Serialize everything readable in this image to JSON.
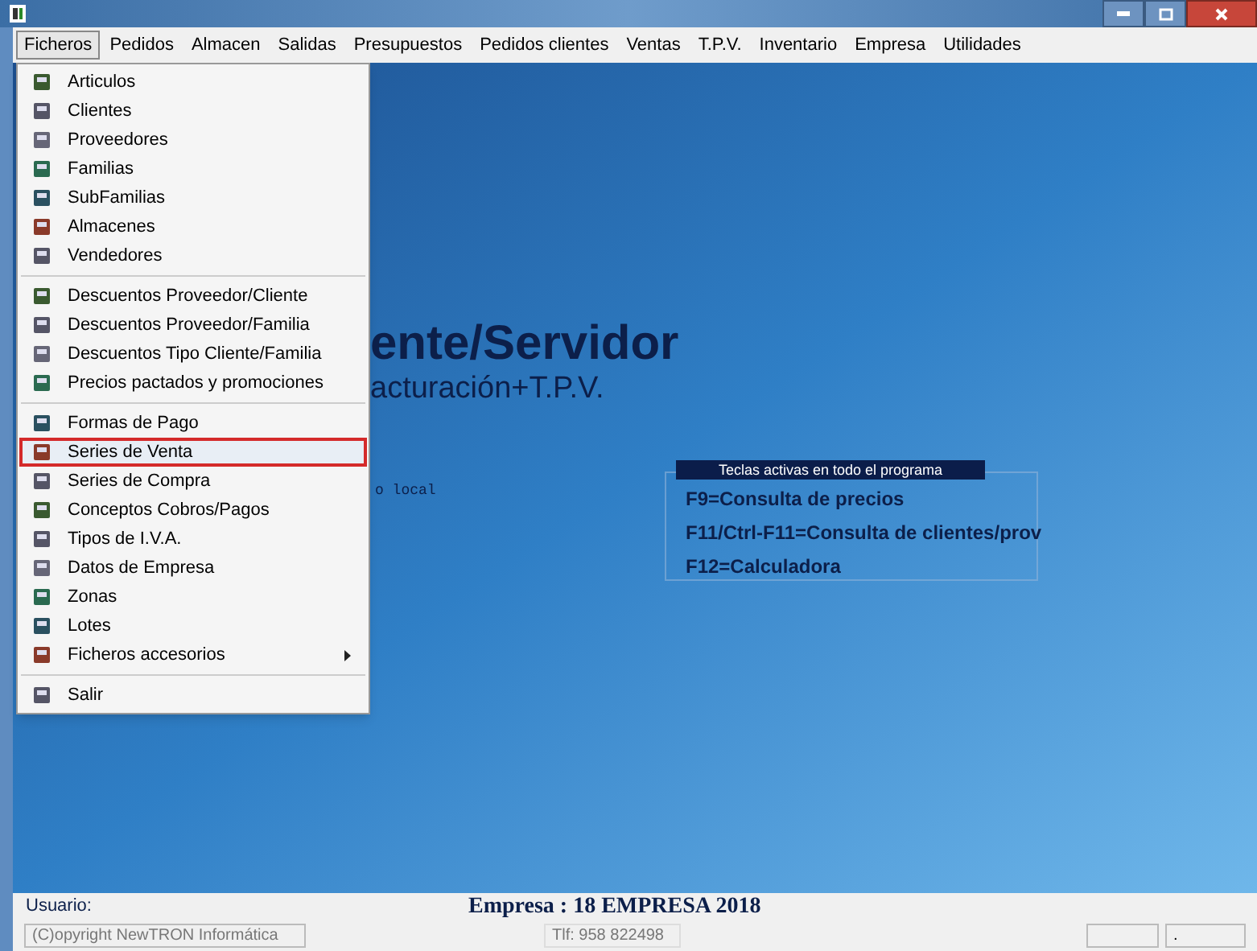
{
  "menu_bar": [
    {
      "label": "Ficheros",
      "selected": true
    },
    {
      "label": "Pedidos",
      "selected": false
    },
    {
      "label": "Almacen",
      "selected": false
    },
    {
      "label": "Salidas",
      "selected": false
    },
    {
      "label": "Presupuestos",
      "selected": false
    },
    {
      "label": "Pedidos clientes",
      "selected": false
    },
    {
      "label": "Ventas",
      "selected": false
    },
    {
      "label": "T.P.V.",
      "selected": false
    },
    {
      "label": "Inventario",
      "selected": false
    },
    {
      "label": "Empresa",
      "selected": false
    },
    {
      "label": "Utilidades",
      "selected": false
    }
  ],
  "dropdown": [
    [
      {
        "label": "Articulos",
        "selected": false
      },
      {
        "label": "Clientes",
        "selected": false
      },
      {
        "label": "Proveedores",
        "selected": false
      },
      {
        "label": "Familias",
        "selected": false
      },
      {
        "label": "SubFamilias",
        "selected": false
      },
      {
        "label": "Almacenes",
        "selected": false
      },
      {
        "label": "Vendedores",
        "selected": false
      }
    ],
    [
      {
        "label": "Descuentos Proveedor/Cliente",
        "selected": false
      },
      {
        "label": "Descuentos Proveedor/Familia",
        "selected": false
      },
      {
        "label": "Descuentos Tipo Cliente/Familia",
        "selected": false
      },
      {
        "label": "Precios pactados y promociones",
        "selected": false
      }
    ],
    [
      {
        "label": "Formas de Pago",
        "selected": false
      },
      {
        "label": "Series de Venta",
        "selected": true
      },
      {
        "label": "Series de Compra",
        "selected": false
      },
      {
        "label": "Conceptos Cobros/Pagos",
        "selected": false
      },
      {
        "label": "Tipos de I.V.A.",
        "selected": false
      },
      {
        "label": "Datos de Empresa",
        "selected": false
      },
      {
        "label": "Zonas",
        "selected": false
      },
      {
        "label": "Lotes",
        "selected": false
      },
      {
        "label": "Ficheros accesorios",
        "selected": false,
        "submenu": true
      }
    ],
    [
      {
        "label": "Salir",
        "selected": false
      }
    ]
  ],
  "splash": {
    "title": "ente/Servidor",
    "subtitle": "acturación+T.P.V.",
    "note": "o local"
  },
  "shortcuts": {
    "header": "Teclas activas en todo el programa",
    "lines": [
      "F9=Consulta de precios",
      "F11/Ctrl-F11=Consulta de clientes/prov",
      "F12=Calculadora"
    ]
  },
  "status": {
    "user_label": "Usuario:",
    "company": "Empresa : 18 EMPRESA 2018",
    "copyright": "(C)opyright NewTRON Informática",
    "phone": "Tlf: 958 822498",
    "field_4": "."
  }
}
